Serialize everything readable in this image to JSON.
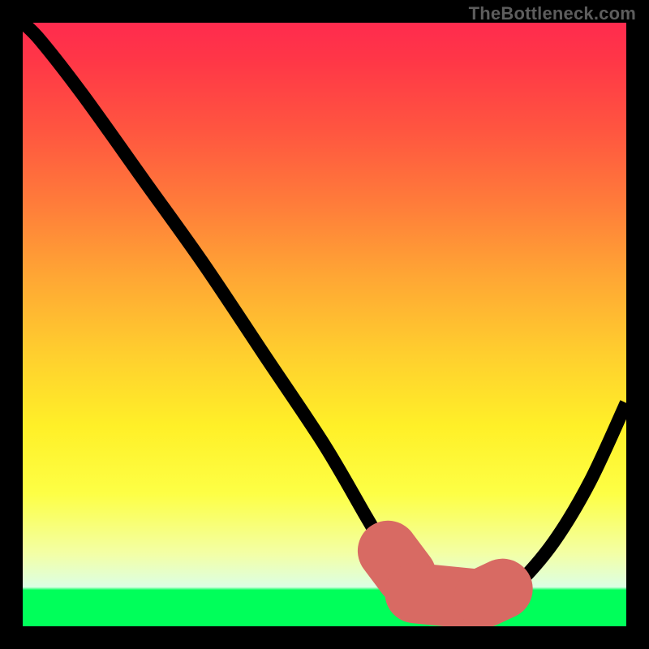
{
  "watermark": "TheBottleneck.com",
  "chart_data": {
    "type": "line",
    "title": "",
    "xlabel": "",
    "ylabel": "",
    "xlim": [
      0,
      100
    ],
    "ylim": [
      0,
      100
    ],
    "series": [
      {
        "name": "curve",
        "x": [
          0,
          3,
          10,
          20,
          30,
          40,
          50,
          57,
          60,
          63,
          67,
          70,
          73,
          75,
          78,
          82,
          88,
          94,
          100
        ],
        "values": [
          100,
          97,
          88,
          74,
          60,
          45,
          30,
          18,
          13,
          9,
          6,
          4.5,
          4,
          4,
          4.5,
          7,
          14,
          24,
          37
        ]
      }
    ],
    "markers": [
      {
        "name": "left-marker",
        "x": [
          60.5,
          63.5
        ],
        "values": [
          12.5,
          8.5
        ]
      },
      {
        "name": "flat-marker",
        "x": [
          65,
          75
        ],
        "values": [
          5.5,
          4.5
        ]
      },
      {
        "name": "right-marker",
        "x": [
          76.5,
          79.5
        ],
        "values": [
          4.8,
          6.2
        ]
      }
    ],
    "background_gradient": {
      "top_color": "#ff2b4e",
      "mid_color": "#ffe628",
      "low_band_color": "#f3ffa6",
      "bottom_color": "#00ff5a"
    },
    "frame_color": "#000000"
  }
}
